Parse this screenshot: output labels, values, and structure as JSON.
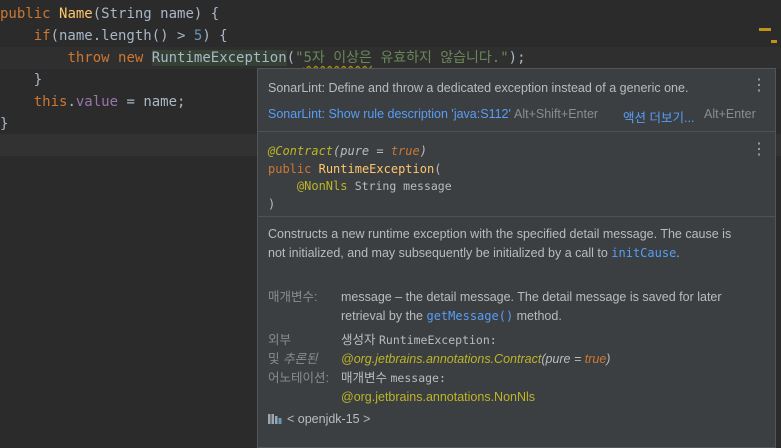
{
  "code": {
    "l1": {
      "kw": "public",
      "name": "Name",
      "rest": "(String name) {"
    },
    "l2": {
      "kw": "if",
      "p1": "(name.length() > ",
      "num": "5",
      "p2": ") {"
    },
    "l3": {
      "kw1": "throw",
      "kw2": "new",
      "cls": "RuntimeException",
      "lp": "(",
      "str_q1": "\"",
      "str_sq": "5자 이상은",
      "str_rest": " 유효하지 않습니다.\"",
      "tail": ");"
    },
    "l4": "}",
    "l5": {
      "kw": "this",
      "dot": ".",
      "field": "value",
      "rest": " = name;"
    },
    "l6": "}"
  },
  "popup": {
    "sonarlint_message": "SonarLint: Define and throw a dedicated exception instead of a generic one.",
    "rule_link": "SonarLint: Show rule description 'java:S112'",
    "rule_shortcut": "Alt+Shift+Enter",
    "more_actions": "액션 더보기...",
    "more_shortcut": "Alt+Enter",
    "signature": {
      "anno": "@Contract",
      "anno_args_a": "(pure = ",
      "anno_true": "true",
      "anno_args_b": ")",
      "kw": "public",
      "ctor": "RuntimeException",
      "paren": "(",
      "param_anno": "@NonNls",
      "param": "String message",
      "close": ")"
    },
    "description_a": "Constructs a new runtime exception with the specified detail message. The cause is not initialized, and may subsequently be initialized by a call to ",
    "description_link": "initCause",
    "description_b": ".",
    "params_label": "매개변수:",
    "params_text_a": "message – the detail message. The detail message is saved for later retrieval by the ",
    "params_link": "getMessage()",
    "params_text_b": " method.",
    "ext_label_1": "외부",
    "ext_label_2": "및 ",
    "ext_label_2_ital": "추론된",
    "ext_label_3": "어노테이션:",
    "ext_ctor_label": "생성자",
    "ext_ctor_name": "RuntimeException:",
    "ext_contract": "@org.jetbrains.annotations.Contract",
    "ext_contract_args_a": "(pure = ",
    "ext_contract_true": "true",
    "ext_contract_args_b": ")",
    "ext_param_label": "매개변수",
    "ext_param_name": "message:",
    "ext_nonnls": "@org.jetbrains.annotations.NonNls",
    "library": "< openjdk-15 >"
  }
}
